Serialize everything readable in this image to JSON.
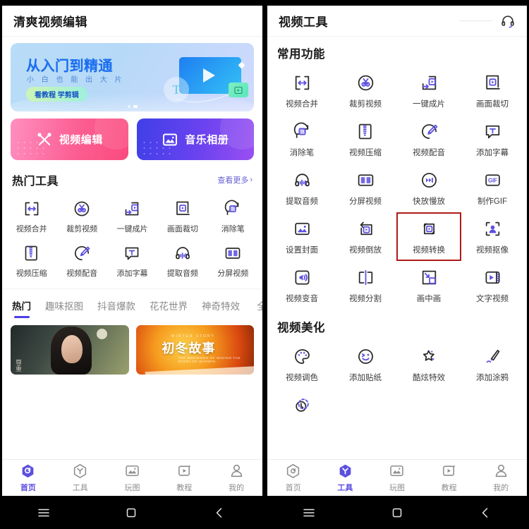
{
  "left": {
    "header": {
      "title": "清爽视频编辑"
    },
    "banner": {
      "title": "从入门到精通",
      "subtitle": "小 白 也 能 出 大 片",
      "pill": "看教程 学剪辑",
      "letter": "T",
      "dots": 2,
      "active_dot": 2
    },
    "cards": [
      {
        "label": "视频编辑",
        "icon": "scissors-cross-icon",
        "color": "#fb4a7e"
      },
      {
        "label": "音乐相册",
        "icon": "photo-mountain-icon",
        "color": "#6b43ef"
      }
    ],
    "section": {
      "title": "热门工具",
      "more": "查看更多",
      "more_chevron": "›"
    },
    "tools": [
      {
        "label": "视频合并",
        "icon": "merge-video-icon"
      },
      {
        "label": "裁剪视频",
        "icon": "trim-video-icon"
      },
      {
        "label": "一键成片",
        "icon": "one-click-film-icon"
      },
      {
        "label": "画面裁切",
        "icon": "crop-frame-icon"
      },
      {
        "label": "消除笔",
        "icon": "eraser-pen-icon"
      },
      {
        "label": "视频压缩",
        "icon": "compress-video-icon"
      },
      {
        "label": "视频配音",
        "icon": "dub-video-icon"
      },
      {
        "label": "添加字幕",
        "icon": "add-subtitle-icon"
      },
      {
        "label": "提取音频",
        "icon": "extract-audio-icon"
      },
      {
        "label": "分屏视频",
        "icon": "split-screen-icon"
      }
    ],
    "tabs": [
      {
        "label": "热门",
        "active": true
      },
      {
        "label": "趣味抠图",
        "active": false
      },
      {
        "label": "抖音爆款",
        "active": false
      },
      {
        "label": "花花世界",
        "active": false
      },
      {
        "label": "神奇特效",
        "active": false
      },
      {
        "label": "全",
        "active": false
      }
    ],
    "thumbs": [
      {
        "caption": "尊重",
        "kind": "portrait"
      },
      {
        "caption": "初冬故事",
        "kind": "autumn",
        "small_top": "WINTER STORY",
        "small_bottom": "THE BEGINNING OF WINTER THE STORY OF WARMTH"
      }
    ],
    "nav": [
      {
        "label": "首页",
        "icon": "home-icon",
        "active": true
      },
      {
        "label": "工具",
        "icon": "tools-hex-icon",
        "active": false
      },
      {
        "label": "玩图",
        "icon": "image-play-icon",
        "active": false
      },
      {
        "label": "教程",
        "icon": "tutorial-play-icon",
        "active": false
      },
      {
        "label": "我的",
        "icon": "profile-icon",
        "active": false
      }
    ]
  },
  "right": {
    "header": {
      "title": "视频工具",
      "support_icon": "headset-icon"
    },
    "sections": [
      {
        "title": "常用功能",
        "items": [
          {
            "label": "视频合并",
            "icon": "merge-video-icon",
            "highlight": false
          },
          {
            "label": "裁剪视频",
            "icon": "trim-video-icon",
            "highlight": false
          },
          {
            "label": "一键成片",
            "icon": "one-click-film-icon",
            "highlight": false
          },
          {
            "label": "画面裁切",
            "icon": "crop-frame-icon",
            "highlight": false
          },
          {
            "label": "消除笔",
            "icon": "eraser-pen-icon",
            "highlight": false
          },
          {
            "label": "视频压缩",
            "icon": "compress-video-icon",
            "highlight": false
          },
          {
            "label": "视频配音",
            "icon": "dub-video-icon",
            "highlight": false
          },
          {
            "label": "添加字幕",
            "icon": "add-subtitle-icon",
            "highlight": false
          },
          {
            "label": "提取音频",
            "icon": "extract-audio-icon",
            "highlight": false
          },
          {
            "label": "分屏视频",
            "icon": "split-screen-icon",
            "highlight": false
          },
          {
            "label": "快放慢放",
            "icon": "speed-icon",
            "highlight": false
          },
          {
            "label": "制作GIF",
            "icon": "gif-icon",
            "highlight": false
          },
          {
            "label": "设置封面",
            "icon": "set-cover-icon",
            "highlight": false
          },
          {
            "label": "视频倒放",
            "icon": "reverse-video-icon",
            "highlight": false
          },
          {
            "label": "视频转换",
            "icon": "convert-video-icon",
            "highlight": true
          },
          {
            "label": "视频抠像",
            "icon": "matting-icon",
            "highlight": false
          },
          {
            "label": "视频变音",
            "icon": "voice-change-icon",
            "highlight": false
          },
          {
            "label": "视频分割",
            "icon": "split-video-icon",
            "highlight": false
          },
          {
            "label": "画中画",
            "icon": "pip-icon",
            "highlight": false
          },
          {
            "label": "文字视频",
            "icon": "text-video-icon",
            "highlight": false
          }
        ]
      },
      {
        "title": "视频美化",
        "items": [
          {
            "label": "视频调色",
            "icon": "palette-icon",
            "highlight": false
          },
          {
            "label": "添加贴纸",
            "icon": "sticker-icon",
            "highlight": false
          },
          {
            "label": "酷炫特效",
            "icon": "star-effect-icon",
            "highlight": false
          },
          {
            "label": "添加涂鸦",
            "icon": "doodle-brush-icon",
            "highlight": false
          },
          {
            "label": "",
            "icon": "rotate-clock-icon",
            "highlight": false
          }
        ]
      }
    ],
    "nav": [
      {
        "label": "首页",
        "icon": "home-icon",
        "active": false
      },
      {
        "label": "工具",
        "icon": "tools-hex-icon",
        "active": true
      },
      {
        "label": "玩图",
        "icon": "image-play-icon",
        "active": false
      },
      {
        "label": "教程",
        "icon": "tutorial-play-icon",
        "active": false
      },
      {
        "label": "我的",
        "icon": "profile-icon",
        "active": false
      }
    ]
  },
  "system_bar": {
    "menu": "menu-icon",
    "home": "home-square-icon",
    "back": "back-chevron-icon"
  },
  "colors": {
    "accent": "#5b4fe0",
    "highlight": "#b01a18",
    "pink": "#fb4a7e",
    "purple": "#6b43ef"
  }
}
